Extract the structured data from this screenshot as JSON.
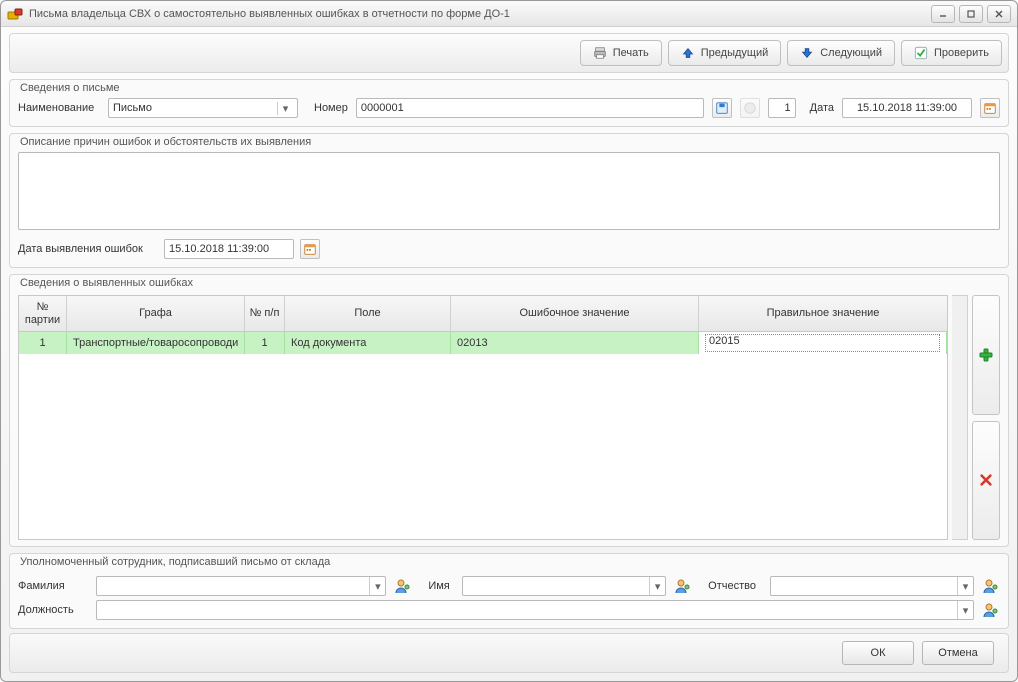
{
  "window": {
    "title": "Письма владельца СВХ о самостоятельно выявленных ошибках в отчетности по форме ДО-1"
  },
  "toolbar": {
    "print": "Печать",
    "prev": "Предыдущий",
    "next": "Следующий",
    "check": "Проверить"
  },
  "letter_info": {
    "group_title": "Сведения о письме",
    "name_label": "Наименование",
    "name_value": "Письмо",
    "number_label": "Номер",
    "number_value": "0000001",
    "number_small": "1",
    "date_label": "Дата",
    "date_value": "15.10.2018 11:39:00"
  },
  "reasons": {
    "group_title": "Описание причин ошибок и обстоятельств их выявления",
    "text": "",
    "detect_date_label": "Дата выявления ошибок",
    "detect_date_value": "15.10.2018 11:39:00"
  },
  "errors": {
    "group_title": "Сведения о выявленных ошибках",
    "columns": {
      "party_no": "№ партии",
      "column": "Графа",
      "row_no": "№ п/п",
      "field": "Поле",
      "wrong": "Ошибочное значение",
      "correct": "Правильное значение"
    },
    "rows": [
      {
        "party_no": "1",
        "column": "Транспортные/товаросопроводи",
        "row_no": "1",
        "field": "Код документа",
        "wrong": "02013",
        "correct": "02015"
      }
    ]
  },
  "employee": {
    "group_title": "Уполномоченный сотрудник, подписавший письмо от склада",
    "lastname_label": "Фамилия",
    "firstname_label": "Имя",
    "middlename_label": "Отчество",
    "position_label": "Должность",
    "lastname": "",
    "firstname": "",
    "middlename": "",
    "position": ""
  },
  "footer": {
    "ok": "ОК",
    "cancel": "Отмена"
  }
}
